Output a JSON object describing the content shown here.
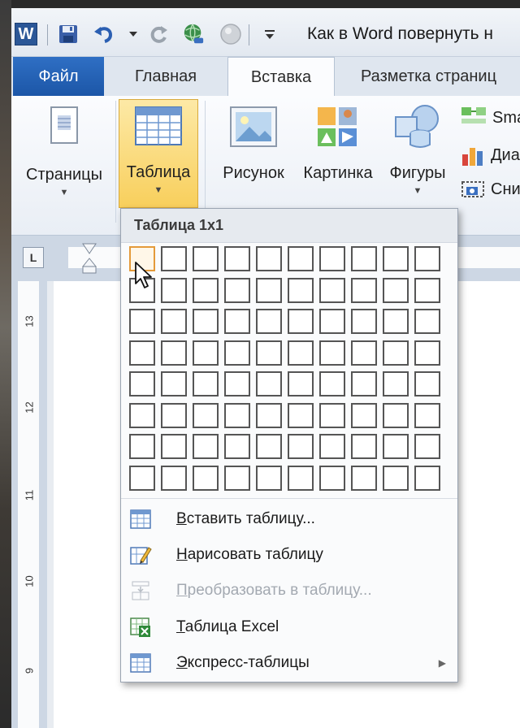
{
  "window": {
    "title": "Как в Word повернуть н",
    "app_letter": "W"
  },
  "tabs": [
    {
      "label": "Файл"
    },
    {
      "label": "Главная"
    },
    {
      "label": "Вставка"
    },
    {
      "label": "Разметка страниц"
    }
  ],
  "ribbon": {
    "pages_label": "Страницы",
    "table_label": "Таблица",
    "picture_label": "Рисунок",
    "clipart_label": "Картинка",
    "shapes_label": "Фигуры",
    "smartart_label": "Sma",
    "chart_label": "Диа",
    "screenshot_label": "Сни"
  },
  "ruler": {
    "tab_stop_symbol": "L",
    "vertical_numbers": [
      "13",
      "12",
      "11",
      "10",
      "9"
    ]
  },
  "table_menu": {
    "title": "Таблица 1x1",
    "grid_columns": 10,
    "grid_rows": 8,
    "selected_columns": 1,
    "selected_rows": 1,
    "items": [
      {
        "label": "Вставить таблицу...",
        "accel": "В",
        "rest": "ставить таблицу...",
        "enabled": true
      },
      {
        "label": "Нарисовать таблицу",
        "accel": "Н",
        "rest": "арисовать таблицу",
        "enabled": true
      },
      {
        "label": "Преобразовать в таблицу...",
        "accel": "П",
        "rest": "реобразовать в таблицу...",
        "enabled": false
      },
      {
        "label": "Таблица Excel",
        "accel": "Т",
        "rest": "аблица Excel",
        "enabled": true
      },
      {
        "label": "Экспресс-таблицы",
        "accel": "Э",
        "rest": "кспресс-таблицы",
        "enabled": true,
        "has_submenu": true
      }
    ]
  },
  "colors": {
    "file_tab": "#1c56a7",
    "table_button_highlight": "#f8cf5c",
    "grid_selected": "#e49a3a"
  }
}
